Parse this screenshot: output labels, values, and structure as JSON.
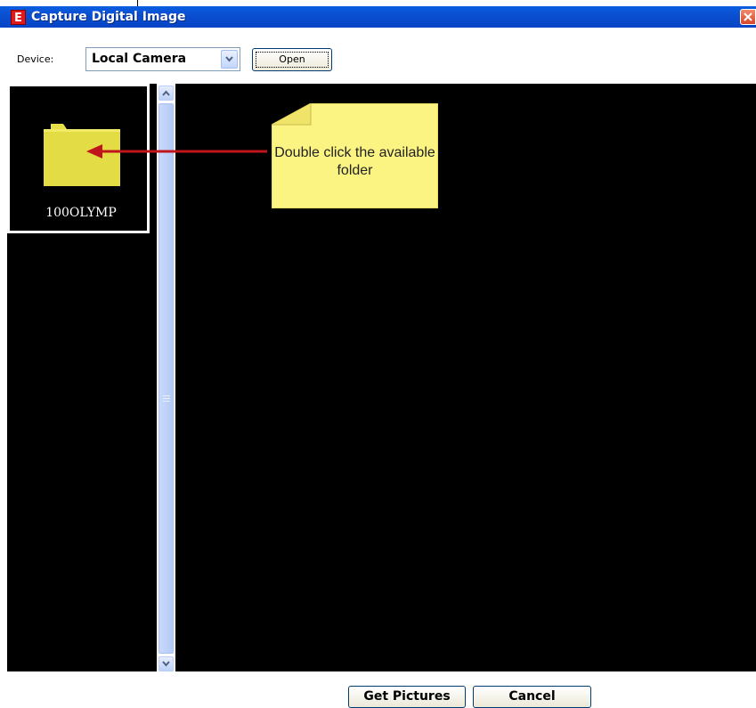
{
  "window": {
    "title": "Capture Digital Image",
    "app_icon_letter": "E"
  },
  "toolbar": {
    "device_label": "Device:",
    "device_value": "Local Camera",
    "open_label": "Open"
  },
  "folders": [
    {
      "name": "100OLYMP"
    }
  ],
  "callout": {
    "text": "Double click the available folder"
  },
  "footer": {
    "get_pictures_label": "Get Pictures",
    "cancel_label": "Cancel"
  },
  "colors": {
    "titlebar": "#0b4fd1",
    "folder": "#e8e04a",
    "callout": "#fbf483",
    "arrow": "#c0161b",
    "panel_bg": "#000000"
  },
  "icons": {
    "app": "app-e-icon",
    "close": "close-icon",
    "dropdown": "chevron-down-icon",
    "folder": "folder-icon",
    "scroll_up": "scroll-up-arrow-icon",
    "scroll_down": "scroll-down-arrow-icon"
  }
}
